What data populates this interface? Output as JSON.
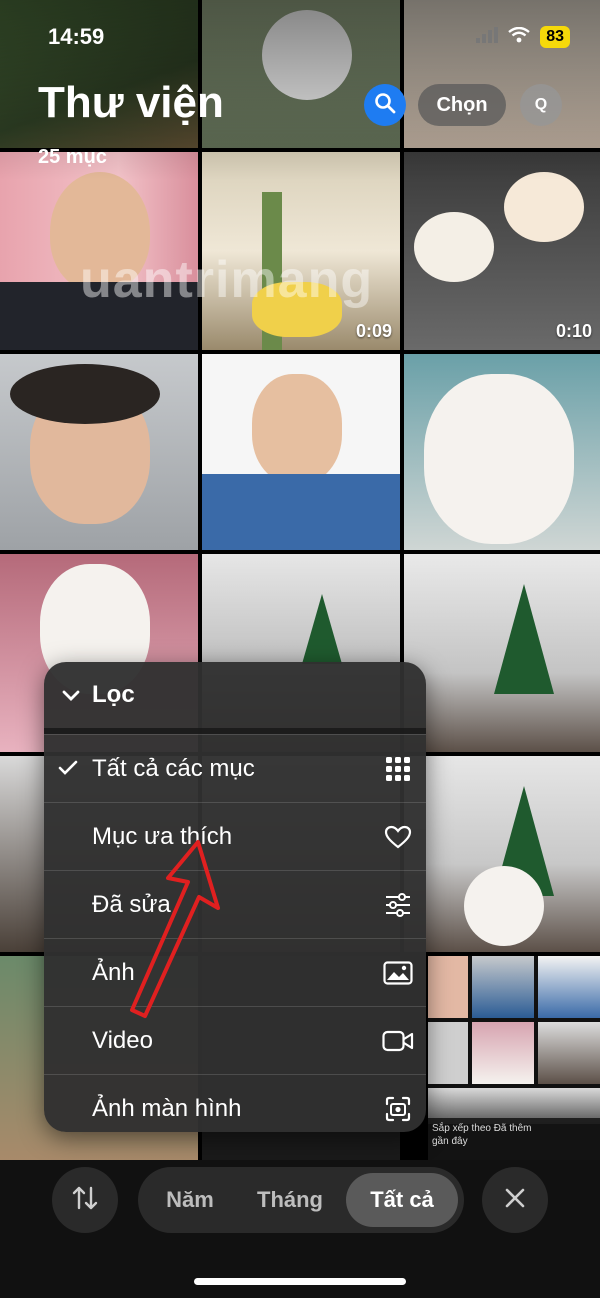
{
  "status": {
    "time": "14:59",
    "battery": "83"
  },
  "header": {
    "title": "Thư viện",
    "count": "25 mục",
    "choose_label": "Chọn",
    "avatar_initial": "Q"
  },
  "watermark": "uantrimang",
  "grid": {
    "durations": [
      "0:09",
      "0:10"
    ]
  },
  "menu": {
    "header": "Lọc",
    "items": [
      {
        "label": "Tất cả các mục",
        "checked": true,
        "icon": "grid-icon"
      },
      {
        "label": "Mục ưa thích",
        "checked": false,
        "icon": "heart-icon"
      },
      {
        "label": "Đã sửa",
        "checked": false,
        "icon": "sliders-icon"
      },
      {
        "label": "Ảnh",
        "checked": false,
        "icon": "photo-icon"
      },
      {
        "label": "Video",
        "checked": false,
        "icon": "video-icon"
      },
      {
        "label": "Ảnh màn hình",
        "checked": false,
        "icon": "screenshot-icon"
      }
    ]
  },
  "mini_caption": "Sắp xếp theo Đã thêm gần đây",
  "bottom": {
    "tabs": [
      "Năm",
      "Tháng",
      "Tất cả"
    ],
    "active": "Tất cả"
  },
  "colors": {
    "accent_blue": "#1e7cf2",
    "annotation_red": "#e02020",
    "battery_yellow": "#f5d90a"
  }
}
